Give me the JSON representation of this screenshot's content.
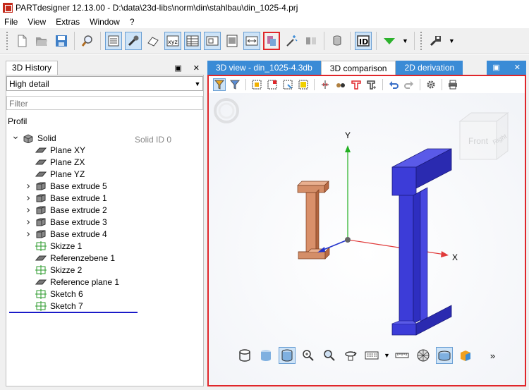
{
  "window": {
    "title": "PARTdesigner 12.13.00 -  D:\\data\\23d-libs\\norm\\din\\stahlbau\\din_1025-4.prj"
  },
  "menu": [
    "File",
    "View",
    "Extras",
    "Window",
    "?"
  ],
  "left_panel": {
    "tab": "3D History",
    "detail_select": "High detail",
    "filter_placeholder": "Filter",
    "profile_label": "Profil",
    "solid_id": "Solid ID 0",
    "tree": [
      {
        "label": "Solid",
        "icon": "solid-icon",
        "expand": "open",
        "level": 0
      },
      {
        "label": "Plane XY",
        "icon": "plane-icon",
        "expand": "",
        "level": 1
      },
      {
        "label": "Plane ZX",
        "icon": "plane-icon",
        "expand": "",
        "level": 1
      },
      {
        "label": "Plane YZ",
        "icon": "plane-icon",
        "expand": "",
        "level": 1
      },
      {
        "label": "Base extrude 5",
        "icon": "extrude-icon",
        "expand": "closed",
        "level": 1
      },
      {
        "label": "Base extrude 1",
        "icon": "extrude-icon",
        "expand": "closed",
        "level": 1
      },
      {
        "label": "Base extrude 2",
        "icon": "extrude-icon",
        "expand": "closed",
        "level": 1
      },
      {
        "label": "Base extrude 3",
        "icon": "extrude-icon",
        "expand": "closed",
        "level": 1
      },
      {
        "label": "Base extrude 4",
        "icon": "extrude-icon",
        "expand": "closed",
        "level": 1
      },
      {
        "label": "Skizze 1",
        "icon": "sketch-icon",
        "expand": "",
        "level": 1
      },
      {
        "label": "Referenzebene 1",
        "icon": "plane-icon",
        "expand": "",
        "level": 1
      },
      {
        "label": "Skizze 2",
        "icon": "sketch-icon",
        "expand": "",
        "level": 1
      },
      {
        "label": "Reference plane 1",
        "icon": "plane-icon",
        "expand": "",
        "level": 1
      },
      {
        "label": "Sketch 6",
        "icon": "sketch-icon",
        "expand": "",
        "level": 1
      },
      {
        "label": "Sketch 7",
        "icon": "sketch-icon",
        "expand": "",
        "level": 1
      }
    ]
  },
  "right_panel": {
    "tabs": [
      "3D view - din_1025-4.3db",
      "3D comparison",
      "2D derivation"
    ],
    "active_tab": "3D comparison",
    "viewport": {
      "axis_y": "Y",
      "axis_x": "X",
      "cube_front": "Front",
      "cube_right": "Right"
    },
    "more_button": "»"
  },
  "panel_buttons": {
    "float": "▣",
    "close": "✕"
  },
  "colors": {
    "accent_blue": "#3a8bd6",
    "highlight_red": "#e0262a",
    "blue_beam": "#3c3cd8",
    "copper_beam": "#d9906a",
    "axis_x": "#e03a3a",
    "axis_y": "#22b022",
    "axis_z": "#2233cc"
  }
}
